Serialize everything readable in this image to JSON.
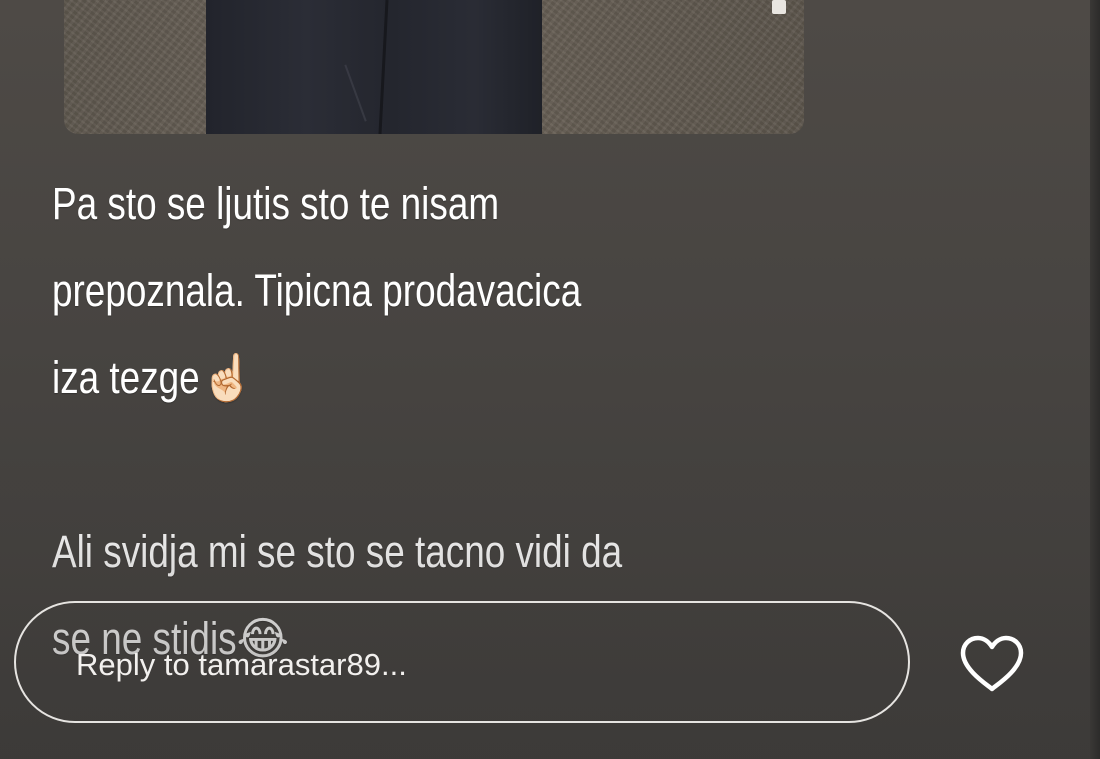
{
  "story": {
    "caption": {
      "line1": "Pa sto se ljutis sto te nisam",
      "line2": "prepoznala. Tipicna prodavacica",
      "line3": "iza tezge",
      "line3_emoji": "☝🏻",
      "line4": "Ali svidja mi se sto se tacno vidi da",
      "line5": "se ne stidis",
      "line5_emoji": "😂"
    },
    "reply": {
      "placeholder": "Reply to tamarastar89..."
    },
    "like": {
      "icon": "heart-outline-icon"
    },
    "colors": {
      "background": "#4a4744",
      "text": "#ffffff",
      "outline": "#e6e4e1"
    }
  }
}
